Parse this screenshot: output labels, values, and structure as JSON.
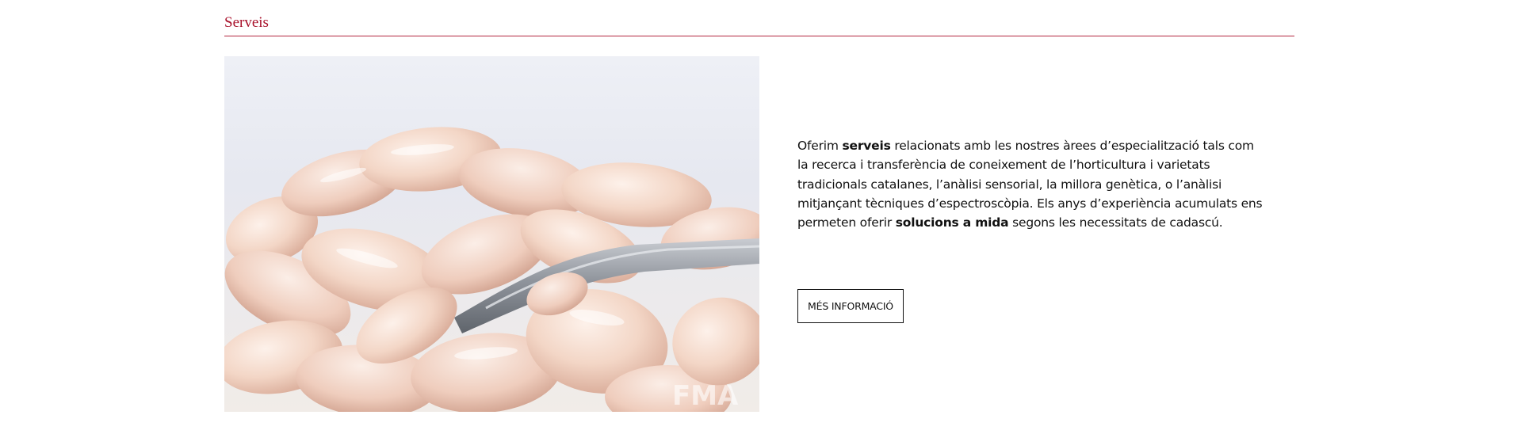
{
  "section": {
    "title": "Serveis"
  },
  "photo": {
    "subject": "white beans with a metal spoon",
    "watermark": "FMA"
  },
  "description": {
    "part1": "Oferim ",
    "bold1": "serveis",
    "part2": " relacionats amb les nostres àrees d’especialització tals com la recerca i transferència de coneixement de l’horticultura i varietats tradicionals catalanes, l’anàlisi sensorial, la millora genètica, o l’anàlisi mitjançant tècniques d’espectroscòpia. Els anys d’experiència acumulats ens permeten oferir ",
    "bold2": "solucions a mida",
    "part3": " segons les necessitats de cadascú."
  },
  "button": {
    "label": "MÉS INFORMACIÓ"
  },
  "colors": {
    "accent": "#a8102a",
    "rule": "#b3283f",
    "text": "#111111"
  }
}
